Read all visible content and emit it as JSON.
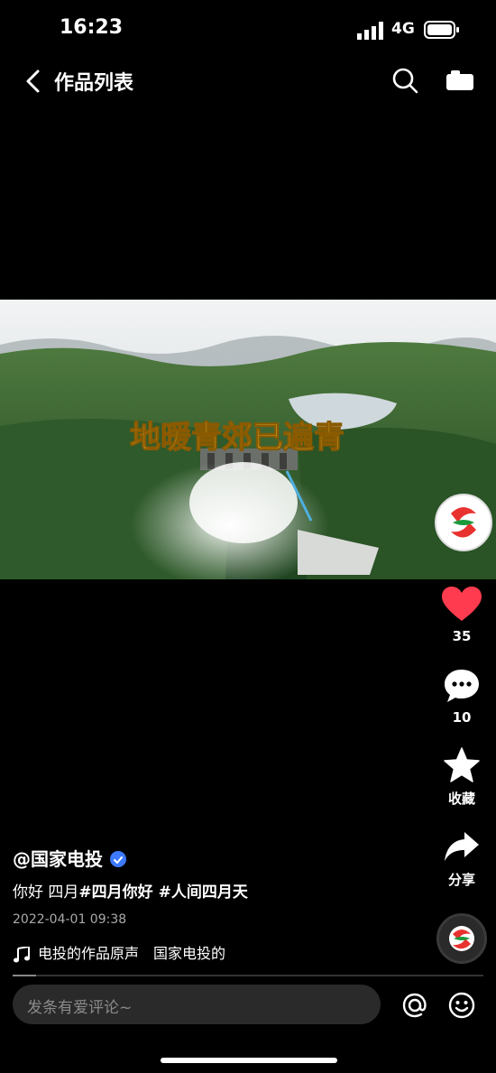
{
  "status_bar": {
    "time": "16:23",
    "network": "4G"
  },
  "nav": {
    "title": "作品列表",
    "back_icon": "chevron-left-icon",
    "search_icon": "search-icon",
    "camera_icon": "camera-icon"
  },
  "video": {
    "overlay_text": "地暖青郊已遍青"
  },
  "actions": {
    "like": {
      "count": "35",
      "icon": "heart-icon",
      "color": "#ff3b4f"
    },
    "comment": {
      "count": "10",
      "icon": "comment-icon"
    },
    "favorite": {
      "label": "收藏",
      "icon": "star-icon"
    },
    "share": {
      "label": "分享",
      "icon": "share-icon"
    }
  },
  "post": {
    "author": "@国家电投",
    "caption_plain": "你好 四月",
    "caption_tags": "#四月你好 #人间四月天",
    "date": "2022-04-01 09:38",
    "music": "电投的作品原声　国家电投的"
  },
  "playback": {
    "progress": 0.05
  },
  "comment_input": {
    "placeholder": "发条有爱评论~"
  },
  "colors": {
    "accent_verified": "#3d79ff",
    "logo_red": "#e8322f",
    "logo_green": "#1a9a3c"
  }
}
